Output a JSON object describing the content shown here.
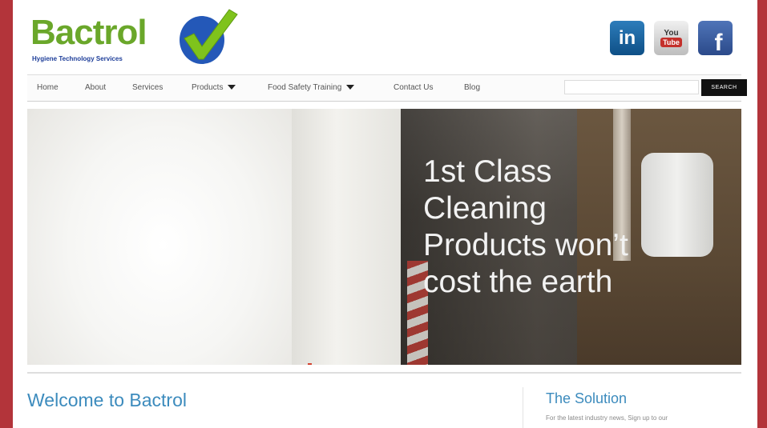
{
  "brand": {
    "name": "Bactrol",
    "tagline": "Hygiene Technology Services",
    "colors": {
      "name": "#6aa72a",
      "tagline": "#1f3f9a",
      "check": "#7fc31c",
      "check_circle": "#2458b8"
    }
  },
  "social": [
    {
      "name": "linkedin-icon",
      "label": "in"
    },
    {
      "name": "youtube-icon",
      "label_top": "You",
      "label_bottom": "Tube"
    },
    {
      "name": "facebook-icon",
      "label": "f"
    }
  ],
  "nav": {
    "items": [
      {
        "label": "Home"
      },
      {
        "label": "About"
      },
      {
        "label": "Services"
      },
      {
        "label": "Products",
        "dropdown": true
      },
      {
        "label": "Food Safety Training",
        "dropdown": true
      },
      {
        "label": "Contact Us"
      },
      {
        "label": "Blog"
      }
    ],
    "search": {
      "value": "",
      "placeholder": "",
      "button_label": "SEARCH"
    }
  },
  "hero": {
    "lines": [
      "1st Class",
      "Cleaning",
      "Products won’t",
      "cost the earth"
    ]
  },
  "main": {
    "heading": "Welcome to Bactrol"
  },
  "sidebar": {
    "heading": "The Solution",
    "text": "For the latest industry news, Sign up to our"
  },
  "colors": {
    "page_bg": "#b3343a",
    "accent_blue": "#3c8bbd",
    "search_button": "#111111"
  }
}
